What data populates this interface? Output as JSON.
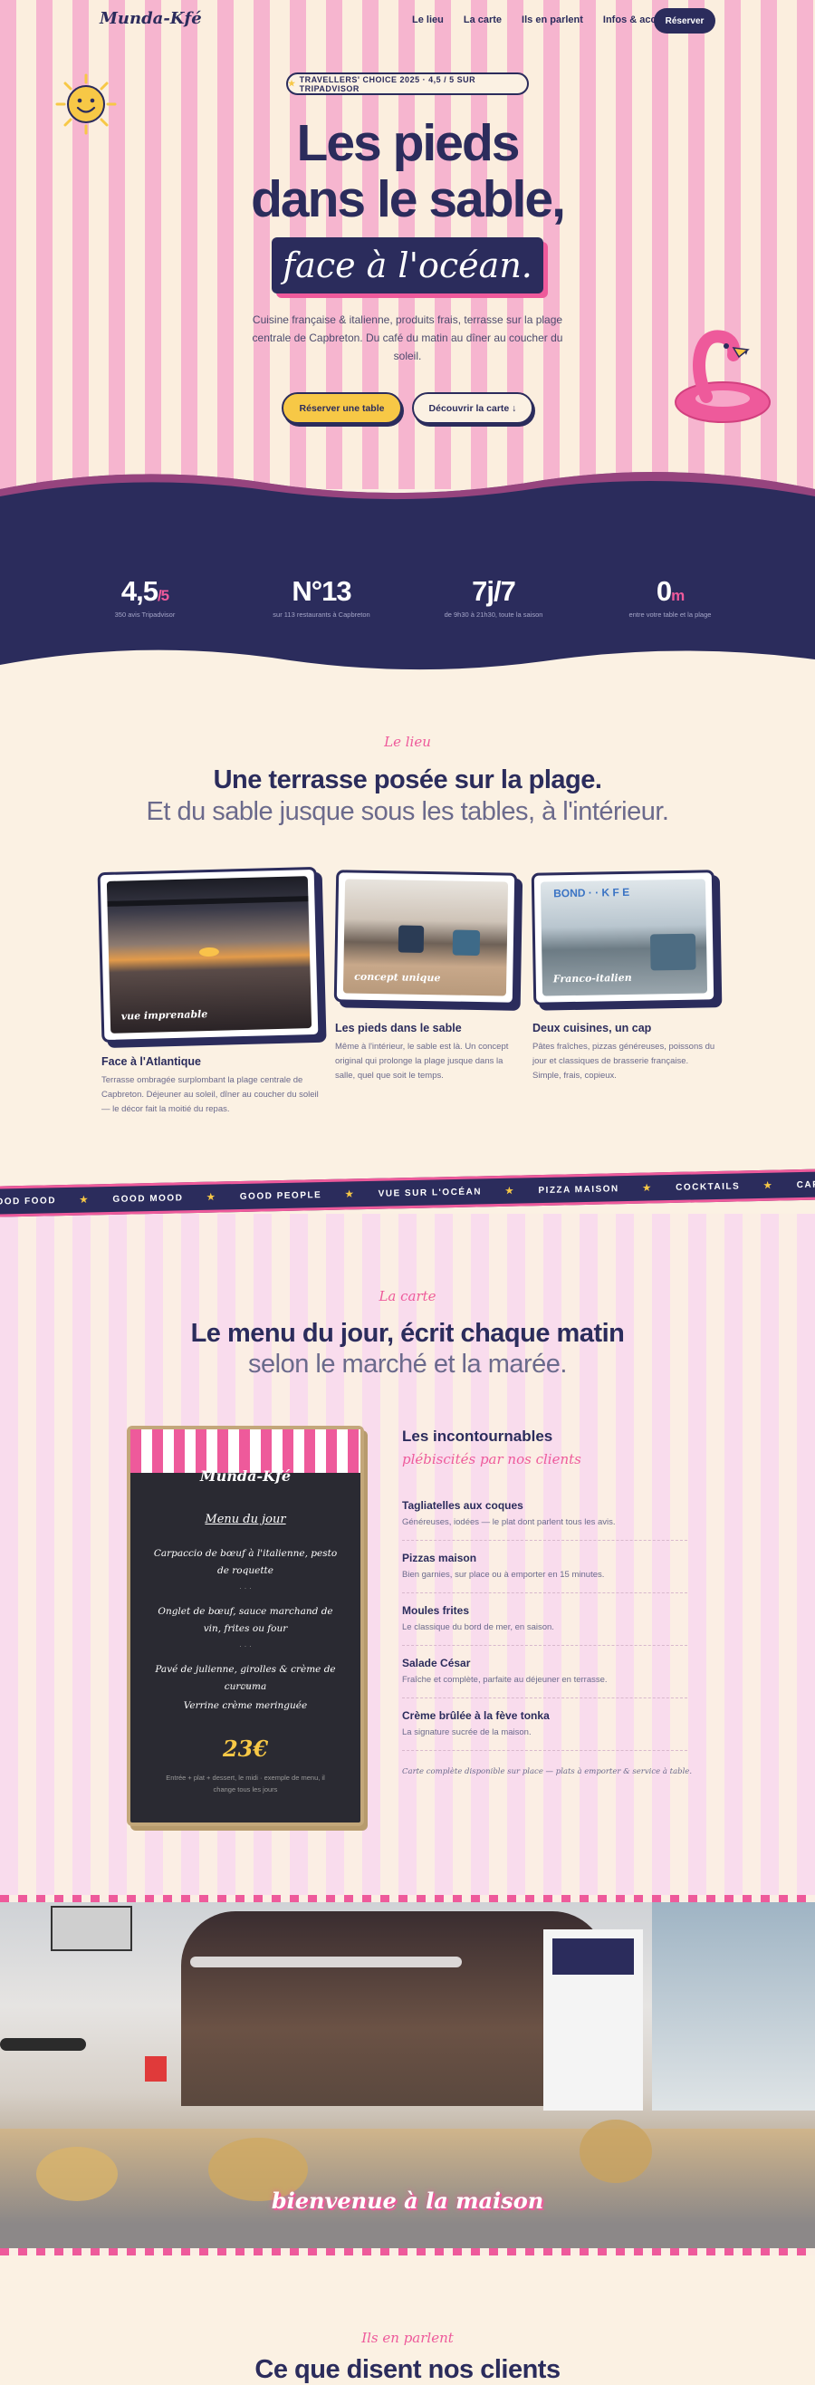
{
  "nav": {
    "logo": "Munda-Kfé",
    "links": [
      "Le lieu",
      "La carte",
      "Ils en parlent",
      "Infos & accès"
    ],
    "cta": "Réserver"
  },
  "hero": {
    "badge": "TRAVELLERS' CHOICE 2025 · 4,5 / 5 SUR TRIPADVISOR",
    "badge_icon": "star-icon",
    "title_line1": "Les pieds",
    "title_line2": "dans le sable,",
    "title_highlight": "face à l'océan.",
    "lede": "Cuisine française & italienne, produits frais, terrasse sur la plage centrale de Capbreton. Du café du matin au dîner au coucher du soleil.",
    "btn_primary": "Réserver une table",
    "btn_secondary": "Découvrir la carte ↓"
  },
  "stats": [
    {
      "value": "4,5",
      "unit": "/5",
      "label": "350 avis Tripadvisor"
    },
    {
      "value": "N°13",
      "unit": "",
      "label": "sur 113 restaurants à Capbreton"
    },
    {
      "value": "7j/7",
      "unit": "",
      "label": "de 9h30 à 21h30, toute la saison"
    },
    {
      "value": "0",
      "unit": "m",
      "label": "entre votre table et la plage"
    }
  ],
  "lieu": {
    "kicker": "Le lieu",
    "title": "Une terrasse posée sur la plage.",
    "subtitle": "Et du sable jusque sous les tables, à l'intérieur.",
    "cards": [
      {
        "caption": "vue imprenable",
        "title": "Face à l'Atlantique",
        "text": "Terrasse ombragée surplombant la plage centrale de Capbreton. Déjeuner au soleil, dîner au coucher du soleil — le décor fait la moitié du repas."
      },
      {
        "caption": "concept unique",
        "title": "Les pieds dans le sable",
        "text": "Même à l'intérieur, le sable est là. Un concept original qui prolonge la plage jusque dans la salle, quel que soit le temps."
      },
      {
        "caption": "Franco-italien",
        "title": "Deux cuisines, un cap",
        "text": "Pâtes fraîches, pizzas généreuses, poissons du jour et classiques de brasserie française. Simple, frais, copieux."
      }
    ]
  },
  "marquee": [
    "DOD FOOD",
    "GOOD MOOD",
    "GOOD PEOPLE",
    "VUE SUR L'OCÉAN",
    "PIZZA MAISON",
    "COCKTAILS",
    "CAPBRETON"
  ],
  "carte": {
    "kicker": "La carte",
    "title": "Le menu du jour, écrit chaque matin",
    "subtitle": "selon le marché et la marée.",
    "board": {
      "brand": "Munda-Kfé",
      "heading": "Menu du jour",
      "items": [
        "Carpaccio de bœuf à l'italienne, pesto de roquette",
        "Onglet de bœuf, sauce marchand de vin, frites ou four",
        "Pavé de julienne, girolles & crème de curcuma",
        "Verrine crème meringuée"
      ],
      "separators": [
        "· · ·",
        "· · ·",
        "— ou —"
      ],
      "price": "23€",
      "note": "Entrée + plat + dessert, le midi · exemple de menu, il change tous les jours"
    },
    "must": {
      "title": "Les incontournables",
      "subtitle": "plébiscités par nos clients",
      "items": [
        {
          "name": "Tagliatelles aux coques",
          "desc": "Généreuses, iodées — le plat dont parlent tous les avis."
        },
        {
          "name": "Pizzas maison",
          "desc": "Bien garnies, sur place ou à emporter en 15 minutes."
        },
        {
          "name": "Moules frites",
          "desc": "Le classique du bord de mer, en saison."
        },
        {
          "name": "Salade César",
          "desc": "Fraîche et complète, parfaite au déjeuner en terrasse."
        },
        {
          "name": "Crème brûlée à la fève tonka",
          "desc": "La signature sucrée de la maison."
        }
      ],
      "footnote": "Carte complète disponible sur place — plats à emporter & service à table."
    }
  },
  "band": {
    "caption": "bienvenue à la maison"
  },
  "reviews": {
    "kicker": "Ils en parlent",
    "title": "Ce que disent nos clients"
  },
  "colors": {
    "navy": "#2b2c5c",
    "pink": "#ee5a9b",
    "yellow": "#f7c846",
    "cream": "#fbf1e3"
  }
}
